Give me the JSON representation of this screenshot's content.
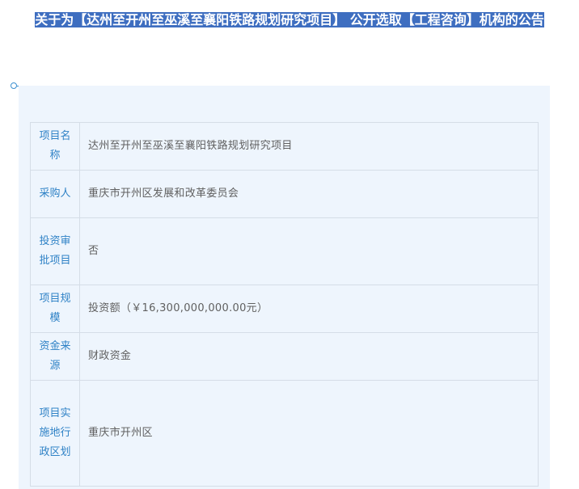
{
  "header": {
    "title": "关于为【达州至开州至巫溪至襄阳铁路规划研究项目】 公开选取【工程咨询】机构的公告"
  },
  "info_table": {
    "rows": [
      {
        "label": "项目名称",
        "value": "达州至开州至巫溪至襄阳铁路规划研究项目"
      },
      {
        "label": "采购人",
        "value": "重庆市开州区发展和改革委员会"
      },
      {
        "label": "投资审批项目",
        "value": "否"
      },
      {
        "label": "项目规模",
        "value": "投资额（￥16,300,000,000.00元）"
      },
      {
        "label": "资金来源",
        "value": "财政资金"
      },
      {
        "label": "项目实施地行政区划",
        "value": "重庆市开州区"
      }
    ]
  },
  "colors": {
    "title_highlight": "#3e6ec0",
    "label_text": "#2f82c6",
    "panel_background": "#eef5fd",
    "divider": "#3b8fd0"
  }
}
